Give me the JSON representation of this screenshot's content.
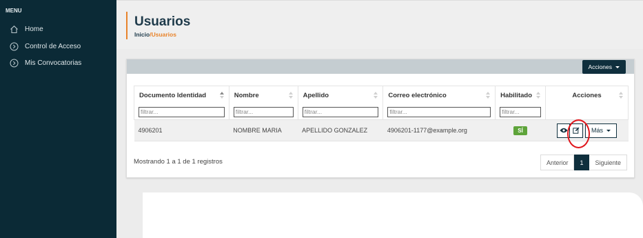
{
  "sidebar": {
    "title": "MENU",
    "items": [
      {
        "label": "Home",
        "icon": "home-icon"
      },
      {
        "label": "Control de Acceso",
        "icon": "chevron-circle-icon"
      },
      {
        "label": "Mis Convocatorias",
        "icon": "chevron-circle-icon"
      }
    ]
  },
  "header": {
    "title": "Usuarios",
    "breadcrumb": {
      "home": "Inicio",
      "separator": "/",
      "current": "Usuarios"
    }
  },
  "toolbar": {
    "acciones_label": "Acciones"
  },
  "table": {
    "columns": [
      "Documento Identidad",
      "Nombre",
      "Apellido",
      "Correo electrónico",
      "Habilitado",
      "Acciones"
    ],
    "filter_placeholder": "filtrar...",
    "rows": [
      {
        "documento": "4906201",
        "nombre": "NOMBRE MARIA",
        "apellido": "APELLIDO GONZALEZ",
        "correo": "4906201-1177@example.org",
        "habilitado": "SÍ",
        "mas_label": "Más"
      }
    ]
  },
  "footer": {
    "info": "Mostrando 1 a 1 de 1 registros",
    "pager": {
      "prev": "Anterior",
      "current": "1",
      "next": "Siguiente"
    }
  },
  "colors": {
    "sidebar": "#0b2a36",
    "accent": "#e8832a",
    "primary": "#0f2f3d",
    "badge": "#5ea43a",
    "highlight": "#e0141a"
  }
}
